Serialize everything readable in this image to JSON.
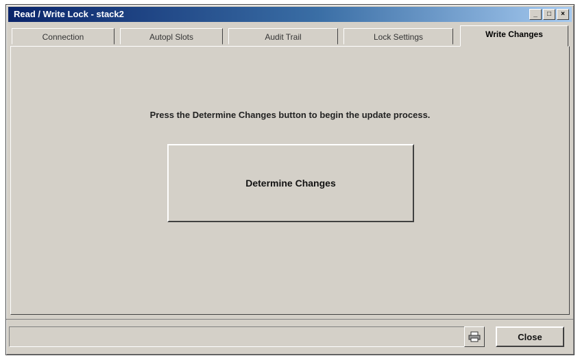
{
  "window": {
    "title": "Read / Write Lock - stack2"
  },
  "window_controls": {
    "minimize": "_",
    "maximize": "□",
    "close": "×"
  },
  "tabs": [
    {
      "label": "Connection"
    },
    {
      "label": "Autopl Slots"
    },
    {
      "label": "Audit Trail"
    },
    {
      "label": "Lock Settings"
    },
    {
      "label": "Write Changes",
      "active": true
    }
  ],
  "main": {
    "instruction": "Press the Determine Changes button to begin the update process.",
    "determine_button": "Determine Changes"
  },
  "footer": {
    "close_label": "Close",
    "print_icon": "printer-icon"
  }
}
